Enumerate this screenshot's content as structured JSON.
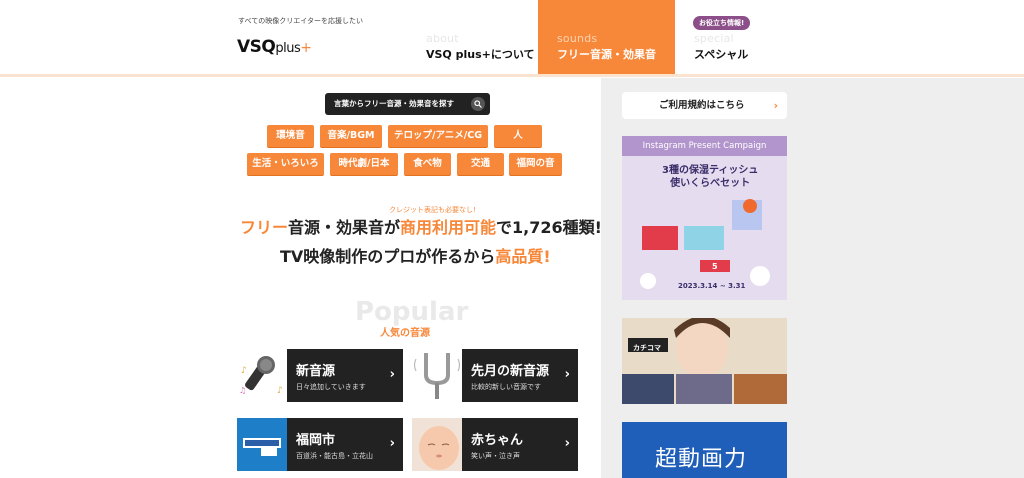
{
  "header": {
    "tagline": "すべての映像クリエイターを応援したい",
    "logo_main": "VSQ",
    "logo_small": "plus",
    "logo_plus": "+",
    "nav": [
      {
        "en": "about",
        "ja": "VSQ plus+について"
      },
      {
        "en": "sounds",
        "ja": "フリー音源・効果音"
      },
      {
        "en": "special",
        "ja": "スペシャル"
      }
    ],
    "badge": "お役立ち情報!"
  },
  "search": {
    "label": "言葉からフリー音源・効果音を探す"
  },
  "categories": {
    "row1": [
      "環境音",
      "音楽/BGM",
      "テロップ/アニメ/CG",
      "人"
    ],
    "row2": [
      "生活・いろいろ",
      "時代劇/日本",
      "食べ物",
      "交通",
      "福岡の音"
    ]
  },
  "headline": {
    "credit": "クレジット表記も必要なし!",
    "line1_a": "フリー",
    "line1_b": "音源・効果音が",
    "line1_c": "商用利用可能",
    "line1_d": "で1,726種類!",
    "line2_a": "TV映像制作のプロが作るから",
    "line2_b": "高品質!"
  },
  "popular": {
    "en": "Popular",
    "ja": "人気の音源",
    "cards": [
      {
        "title": "新音源",
        "sub": "日々追加していきます"
      },
      {
        "title": "先月の新音源",
        "sub": "比較的新しい音源です"
      },
      {
        "title": "福岡市",
        "sub": "百道浜・能古島・立花山"
      },
      {
        "title": "赤ちゃん",
        "sub": "笑い声・泣き声"
      }
    ]
  },
  "sidebar": {
    "terms": "ご利用規約はこちら",
    "ad1_head": "Instagram Present Campaign",
    "ad1_title_1": "3種の保湿ティッシュ",
    "ad1_title_2": "使いくらべセット",
    "ad1_date": "2023.3.14 ~ 3.31",
    "ad2_label": "カチコマ",
    "ad3_text": "超動画力"
  },
  "colors": {
    "accent": "#f7883a",
    "dark": "#222222",
    "badge": "#8c4f8a"
  }
}
